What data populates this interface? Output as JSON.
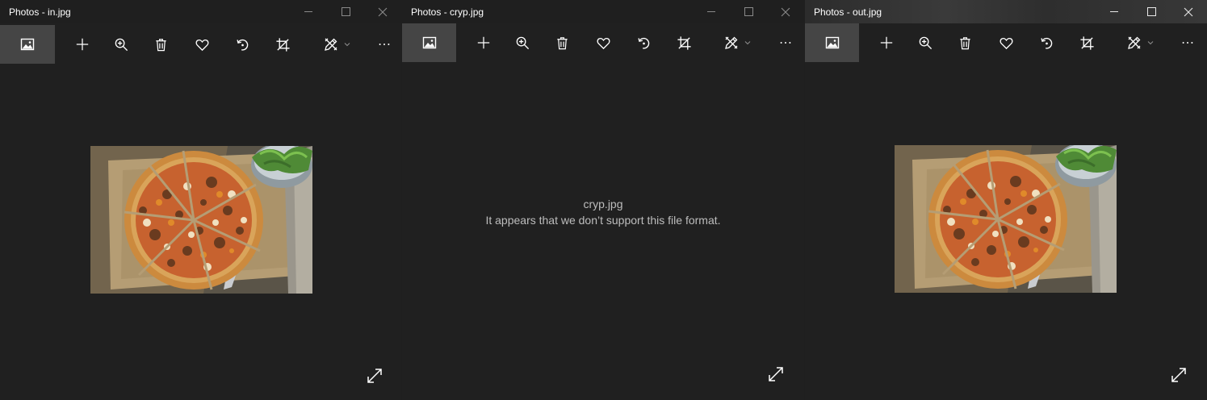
{
  "windows": [
    {
      "title": "Photos - in.jpg",
      "content": "image"
    },
    {
      "title": "Photos - cryp.jpg",
      "content": "error",
      "error_filename": "cryp.jpg",
      "error_message": "It appears that we don’t support this file format."
    },
    {
      "title": "Photos - out.jpg",
      "content": "image"
    }
  ],
  "toolbar_icons": [
    "gallery-icon",
    "add-icon",
    "zoom-in-icon",
    "delete-icon",
    "favorite-icon",
    "rotate-icon",
    "crop-icon",
    "edit-draw-icon",
    "more-icon"
  ],
  "colors": {
    "background": "#202020",
    "toolbar_active": "#454545",
    "text": "#ffffff",
    "error_text": "#bdbdbd"
  }
}
